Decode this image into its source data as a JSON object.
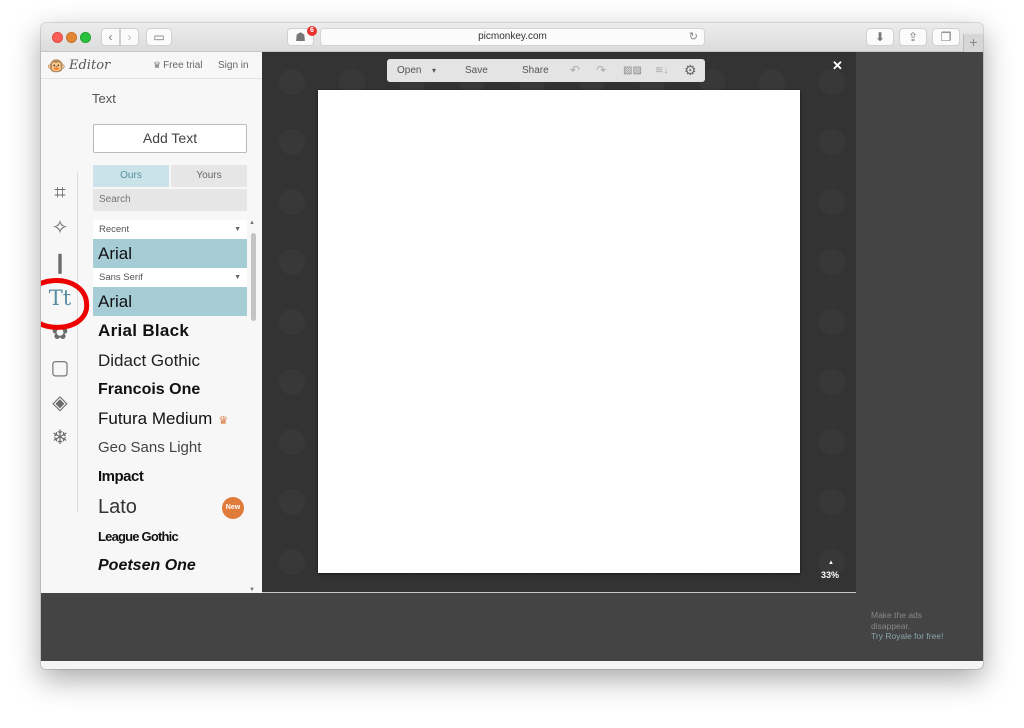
{
  "browser": {
    "url": "picmonkey.com",
    "extension_badge_count": "6",
    "icons": {
      "back": "‹",
      "forward": "›",
      "sidebar": "▭",
      "ghost": "☗",
      "reload": "↻",
      "download": "⬇",
      "share": "⇪",
      "tabs": "❐",
      "new_tab": "+"
    }
  },
  "header": {
    "logo_text": "Editor",
    "free_trial": "Free trial",
    "sign_in": "Sign in"
  },
  "tools": [
    {
      "name": "crop",
      "glyph": "⌗"
    },
    {
      "name": "effects",
      "glyph": "✧"
    },
    {
      "name": "touch-up",
      "glyph": "❙"
    },
    {
      "name": "text",
      "glyph": "Tt",
      "active": true
    },
    {
      "name": "overlays",
      "glyph": "✿"
    },
    {
      "name": "frames",
      "glyph": "▢"
    },
    {
      "name": "textures",
      "glyph": "◈"
    },
    {
      "name": "themes",
      "glyph": "❄"
    }
  ],
  "text_panel": {
    "title": "Text",
    "add_text": "Add Text",
    "tabs": [
      {
        "label": "Ours",
        "active": true
      },
      {
        "label": "Yours",
        "active": false
      }
    ],
    "search_placeholder": "Search",
    "recent_label": "Recent",
    "recent_font": "Arial",
    "category_label": "Sans Serif",
    "selected_font": "Arial",
    "fonts": [
      {
        "name": "Arial Black"
      },
      {
        "name": "Didact Gothic"
      },
      {
        "name": "Francois One"
      },
      {
        "name": "Futura Medium",
        "badge": "royale"
      },
      {
        "name": "Geo Sans Light"
      },
      {
        "name": "Impact"
      },
      {
        "name": "Lato",
        "badge": "New"
      },
      {
        "name": "League Gothic"
      },
      {
        "name": "Poetsen One"
      }
    ]
  },
  "toolbar": {
    "open": "Open",
    "save": "Save",
    "share": "Share",
    "icons": {
      "dropdown": "▾",
      "undo": "↶",
      "redo": "↷",
      "compare": "▨▨",
      "layers": "≋↓",
      "settings": "⚙"
    }
  },
  "canvas": {
    "close": "✕",
    "zoom_level": "33%",
    "zoom_caret": "▲"
  },
  "ad": {
    "line1": "Make the ads",
    "line2": "disappear.",
    "link": "Try Royale for free!"
  },
  "annotation": {
    "color": "#ee0000",
    "target": "text-tool"
  }
}
